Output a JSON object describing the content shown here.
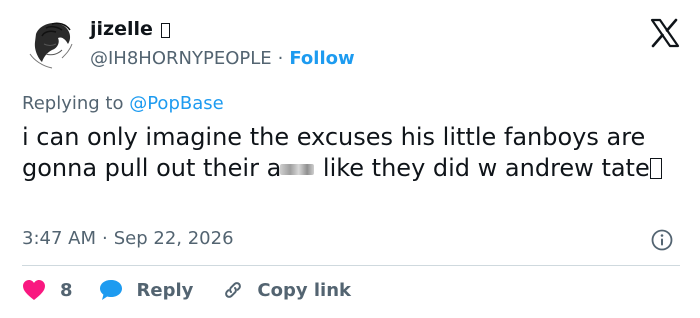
{
  "author": {
    "display_name": "jizelle",
    "handle": "@IH8HORNYPEOPLE",
    "separator": "·",
    "follow_label": "Follow"
  },
  "reply_context": {
    "prefix": "Replying to",
    "mention": "@PopBase"
  },
  "tweet": {
    "text_before_censor": "i can only imagine the excuses his little fanboys are gonna pull out their a",
    "text_after_censor": " like they did w andrew tate"
  },
  "meta": {
    "time": "3:47 AM",
    "separator": "·",
    "date": "Sep 22, 2026"
  },
  "actions": {
    "like_count": "8",
    "reply_label": "Reply",
    "copy_label": "Copy link"
  },
  "colors": {
    "accent": "#1d9bf0",
    "like": "#f91880",
    "secondary_text": "#536471",
    "primary_text": "#0f1419",
    "divider": "#cfd9de"
  },
  "icons": {
    "brand": "x-logo-icon",
    "info": "info-icon",
    "like": "heart-icon",
    "reply": "speech-bubble-icon",
    "copy": "link-icon"
  }
}
